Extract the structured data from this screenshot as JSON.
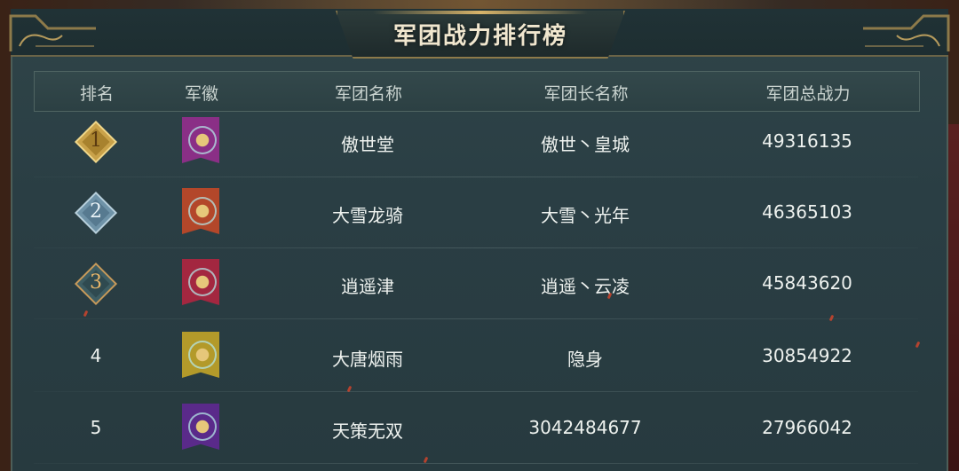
{
  "title": "军团战力排行榜",
  "columns": {
    "rank": "排名",
    "emblem": "军徽",
    "name": "军团名称",
    "leader": "军团长名称",
    "power": "军团总战力"
  },
  "rows": [
    {
      "rank": "1",
      "name": "傲世堂",
      "leader": "傲世丶皇城",
      "power": "49316135",
      "emblem_color": "#8a2f86",
      "badge": "gold"
    },
    {
      "rank": "2",
      "name": "大雪龙骑",
      "leader": "大雪丶光年",
      "power": "46365103",
      "emblem_color": "#b3472a",
      "badge": "silver"
    },
    {
      "rank": "3",
      "name": "逍遥津",
      "leader": "逍遥丶云凌",
      "power": "45843620",
      "emblem_color": "#a32740",
      "badge": "bronze"
    },
    {
      "rank": "4",
      "name": "大唐烟雨",
      "leader": "隐身",
      "power": "30854922",
      "emblem_color": "#b39a2a",
      "badge": "none"
    },
    {
      "rank": "5",
      "name": "天策无双",
      "leader": "3042484677",
      "power": "27966042",
      "emblem_color": "#5a2a8a",
      "badge": "none"
    }
  ],
  "colors": {
    "gold": "#c9a24a",
    "silver": "#6f93a8",
    "bronze": "#3d5d63"
  }
}
